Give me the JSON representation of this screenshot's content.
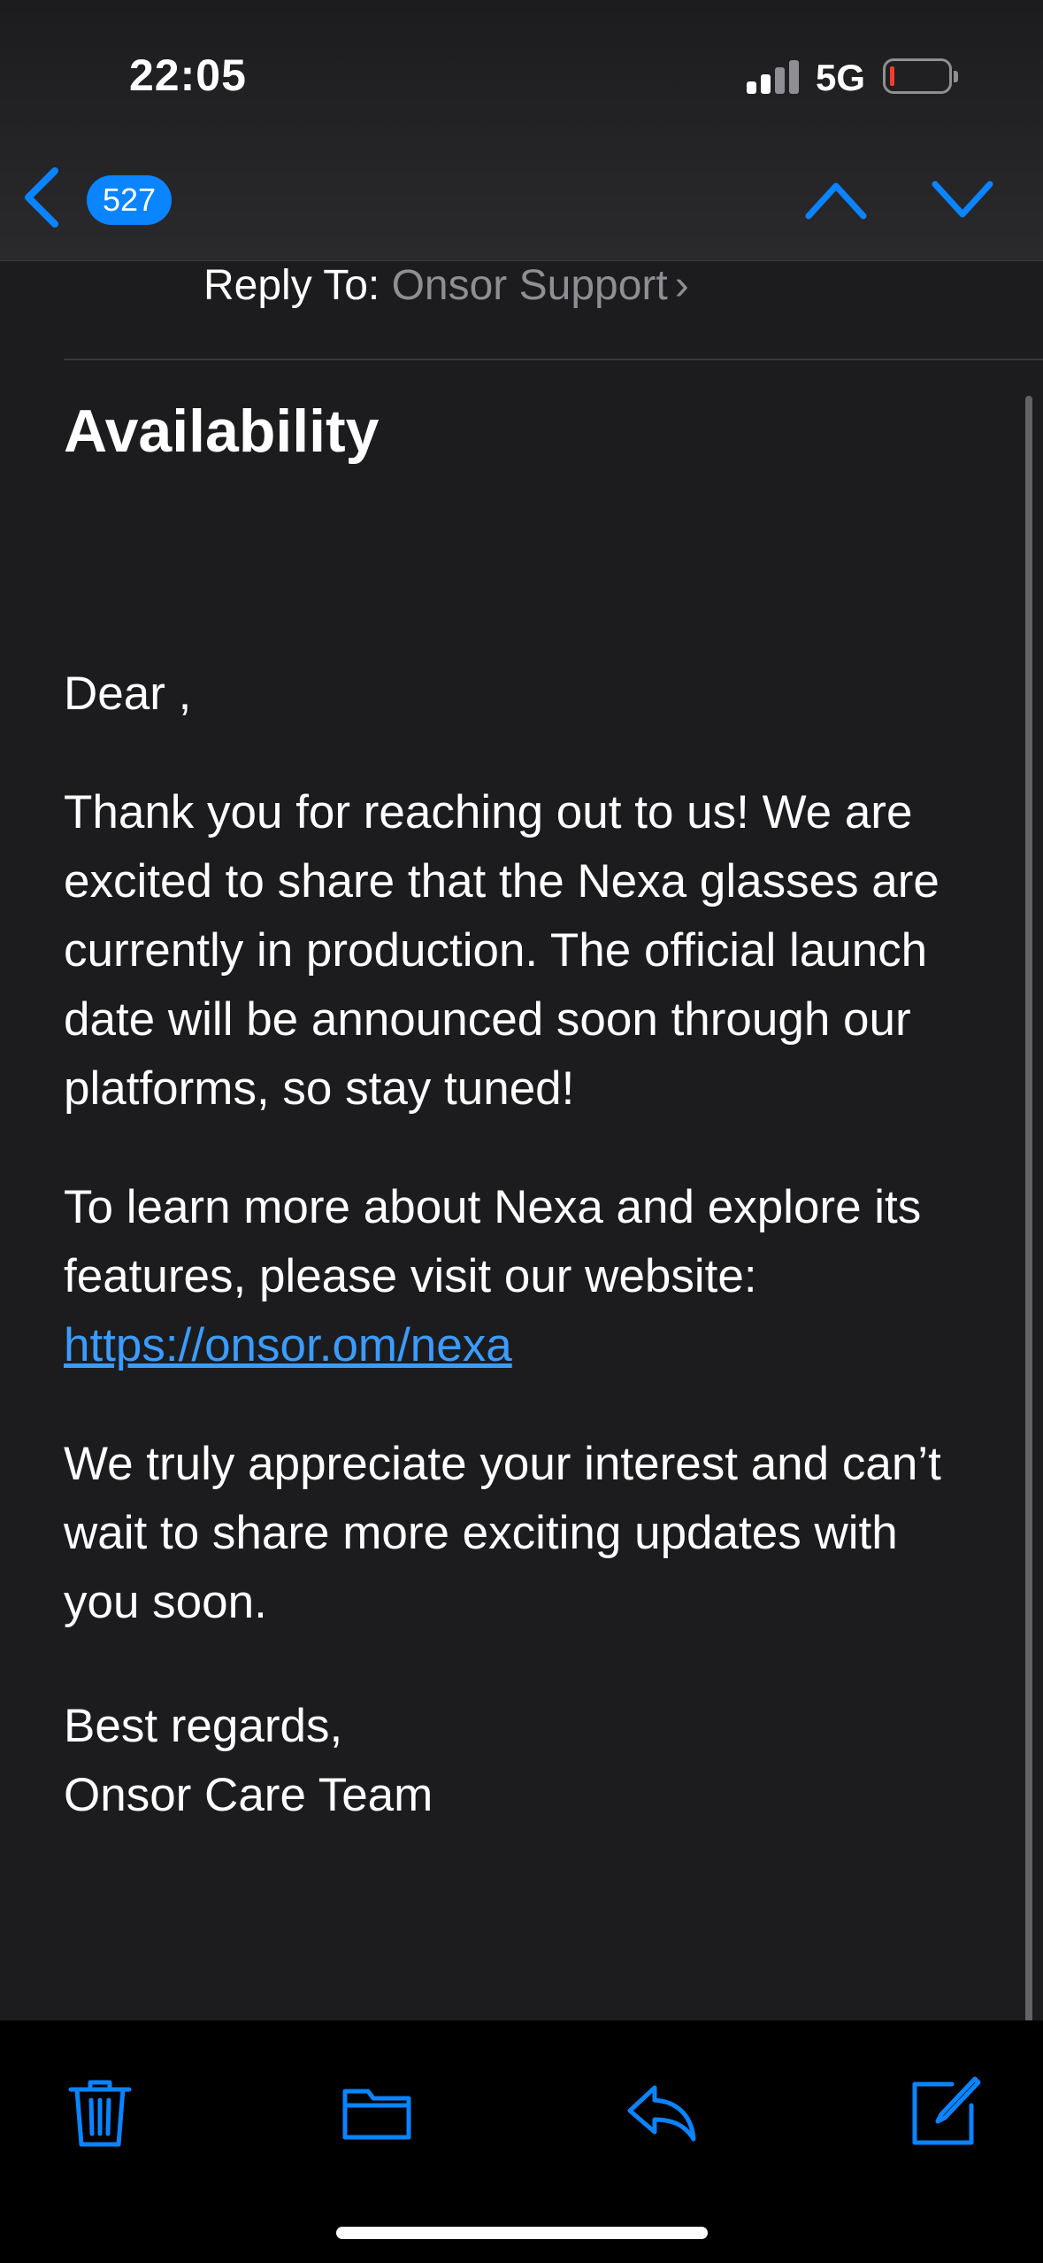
{
  "status_bar": {
    "time": "22:05",
    "network": "5G",
    "battery_color": "#ff3b30"
  },
  "nav": {
    "unread_count": "527",
    "back_icon": "chevron-left-icon",
    "prev_icon": "chevron-up-icon",
    "next_icon": "chevron-down-icon",
    "accent_color": "#0a84ff"
  },
  "header": {
    "reply_to_label": "Reply To:",
    "reply_to_value": "Onsor Support",
    "reply_to_chevron": "›"
  },
  "email": {
    "subject": "Availability",
    "greeting": "Dear ,",
    "paragraph_1": "Thank you for reaching out to us! We are excited to share that the Nexa glasses are currently in production. The official launch date will be announced soon through our platforms, so stay tuned!",
    "paragraph_2_text": "To learn more about Nexa and explore its features, please visit our website:",
    "website_link": "https://onsor.om/nexa",
    "paragraph_3": "We truly appreciate your interest and can’t wait to share more exciting updates with you soon.",
    "signoff": "Best regards,",
    "signature": "Onsor Care Team"
  },
  "toolbar": {
    "items": [
      {
        "name": "trash-icon"
      },
      {
        "name": "folder-icon"
      },
      {
        "name": "reply-icon"
      },
      {
        "name": "compose-icon"
      }
    ]
  }
}
